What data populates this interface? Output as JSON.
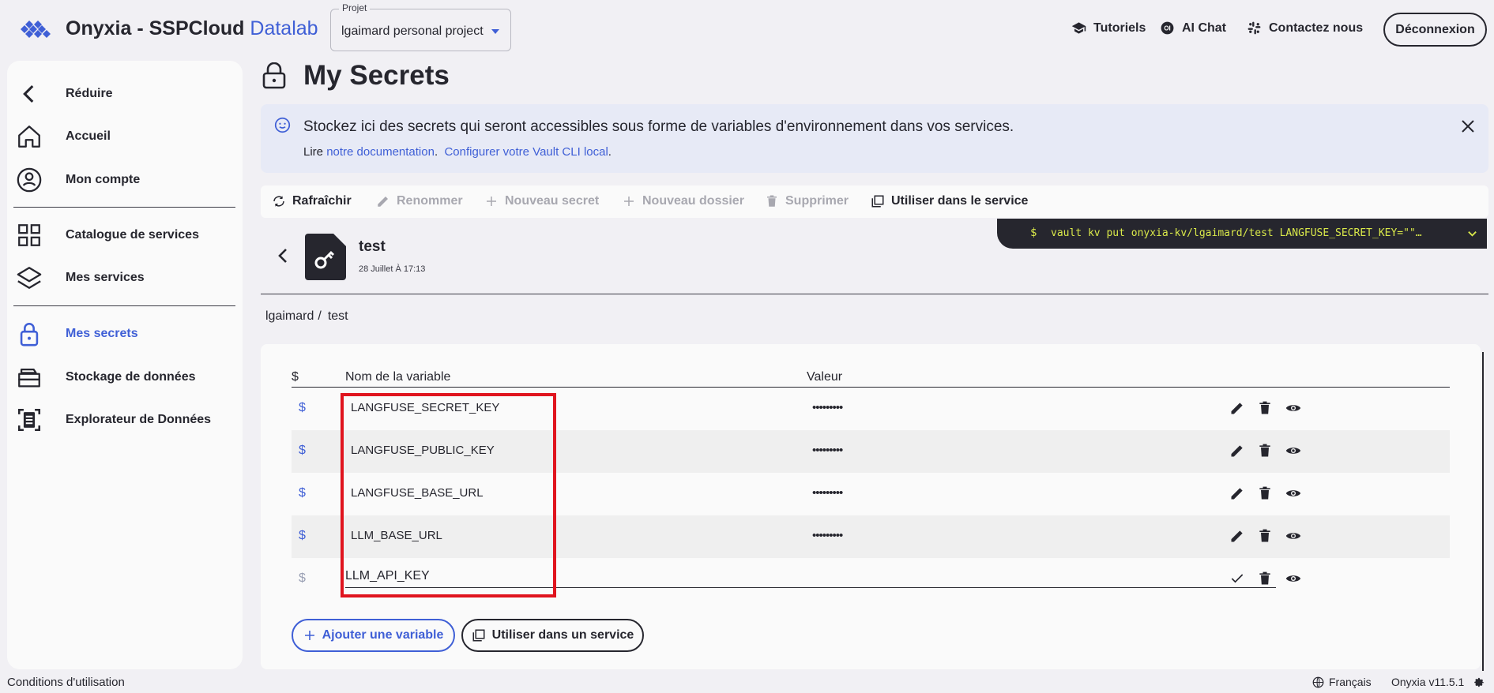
{
  "header": {
    "brand_name": "Onyxia - SSPCloud",
    "brand_accent": "Datalab",
    "project_legend": "Projet",
    "project_value": "lgaimard personal project",
    "links": [
      {
        "label": "Tutoriels",
        "icon": "graduation-cap-icon"
      },
      {
        "label": "AI Chat",
        "icon": "ai-chat-icon"
      },
      {
        "label": "Contactez nous",
        "icon": "slack-icon"
      }
    ],
    "logout_label": "Déconnexion"
  },
  "sidebar": {
    "items": [
      {
        "label": "Réduire",
        "icon": "chevron-left-icon"
      },
      {
        "label": "Accueil",
        "icon": "home-icon"
      },
      {
        "label": "Mon compte",
        "icon": "account-icon"
      },
      {
        "label": "Catalogue de services",
        "icon": "grid-icon"
      },
      {
        "label": "Mes services",
        "icon": "layers-icon"
      },
      {
        "label": "Mes secrets",
        "icon": "lock-icon",
        "active": true
      },
      {
        "label": "Stockage de données",
        "icon": "storage-icon"
      },
      {
        "label": "Explorateur de Données",
        "icon": "data-explorer-icon"
      }
    ]
  },
  "page": {
    "title": "My Secrets",
    "alert": {
      "title": "Stockez ici des secrets qui seront accessibles sous forme de variables d'environnement dans vos services.",
      "prefix": "Lire ",
      "link1": "notre documentation",
      "link2": "Configurer votre Vault CLI local"
    },
    "toolbar": {
      "refresh": "Rafraîchir",
      "rename": "Renommer",
      "new_secret": "Nouveau secret",
      "new_folder": "Nouveau dossier",
      "delete": "Supprimer",
      "use_in_service": "Utiliser dans le service"
    },
    "terminal": {
      "prompt": "$",
      "command": "vault kv put onyxia-kv/lgaimard/test LANGFUSE_SECRET_KEY=\"\"…"
    },
    "secret": {
      "name": "test",
      "date": "28 Juillet À 17:13"
    },
    "breadcrumb": {
      "root": "lgaimard",
      "separator": "/",
      "current": "test"
    }
  },
  "table": {
    "headers": {
      "dollar": "$",
      "name": "Nom de la variable",
      "value": "Valeur"
    },
    "rows": [
      {
        "dollar": "$",
        "name": "LANGFUSE_SECRET_KEY",
        "value": "•••••••••"
      },
      {
        "dollar": "$",
        "name": "LANGFUSE_PUBLIC_KEY",
        "value": "•••••••••"
      },
      {
        "dollar": "$",
        "name": "LANGFUSE_BASE_URL",
        "value": "•••••••••"
      },
      {
        "dollar": "$",
        "name": "LLM_BASE_URL",
        "value": "•••••••••"
      }
    ],
    "editing_row": {
      "dollar": "$",
      "name": "LLM_API_KEY"
    },
    "add_variable": "Ajouter une variable",
    "use_in_service": "Utiliser dans un service"
  },
  "footer": {
    "terms": "Conditions d'utilisation",
    "language": "Français",
    "version": "Onyxia v11.5.1"
  },
  "colors": {
    "accent": "#3f5fd6",
    "text": "#26262e",
    "background": "#f1f0f4",
    "highlight": "#e0141e",
    "terminal_bg": "#26262e",
    "terminal_text": "#d9e84a"
  }
}
